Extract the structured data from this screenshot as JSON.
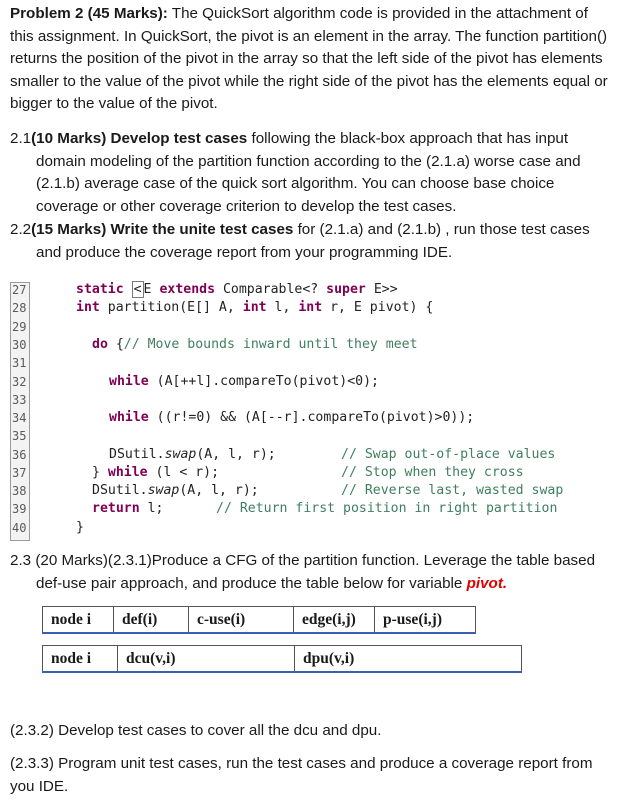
{
  "problem": {
    "heading": "Problem 2 (45 Marks):",
    "intro_1": " The QuickSort algorithm code is provided in the attachment of this assignment. In QuickSort, the pivot is an element in the array. The function partition() returns the position of the pivot in the array so that the left side of the pivot has elements smaller to the value of the pivot while the right side of the pivot has the elements equal or bigger to the value of the pivot."
  },
  "q21": {
    "num": "2.1",
    "bold": "(10 Marks) Develop test cases",
    "text": " following the black-box approach that has input domain modeling of the partition function according to the (2.1.a) worse case and (2.1.b) average case of the quick sort algorithm. You can choose base choice coverage or other coverage criterion to develop the test cases."
  },
  "q22": {
    "num": "2.2",
    "bold": "(15 Marks) Write the unite test cases",
    "text": " for (2.1.a) and (2.1.b) , run those test cases and produce the coverage report from your programming IDE."
  },
  "code": {
    "line_numbers": [
      "27",
      "28",
      "29",
      "30",
      "31",
      "32",
      "33",
      "34",
      "35",
      "36",
      "37",
      "38",
      "39",
      "40"
    ],
    "l27_kw": "static",
    "l27_rest": "E ",
    "l27_kw2": "extends",
    "l27_end": " Comparable<? ",
    "l27_kw3": "super",
    "l27_tail": " E>>",
    "l28_kw": "int",
    "l28_a": " partition(E[] A, ",
    "l28_kw2": "int",
    "l28_b": " l, ",
    "l28_kw3": "int",
    "l28_c": " r, E pivot) {",
    "l30_kw": "do",
    "l30_a": " {",
    "l30_cm": "// Move bounds inward until they meet",
    "l32_kw": "while",
    "l32_a": " (A[++l].compareTo(pivot)<0);",
    "l34_kw": "while",
    "l34_a": " ((r!=0) && (A[--r].compareTo(pivot)>0));",
    "l36_a": "DSutil.",
    "l36_it": "swap",
    "l36_b": "(A, l, r);",
    "l36_cm": "// Swap out-of-place values",
    "l37_a": "} ",
    "l37_kw": "while",
    "l37_b": " (l < r);",
    "l37_cm": "// Stop when they cross",
    "l38_a": "DSutil.",
    "l38_it": "swap",
    "l38_b": "(A, l, r);",
    "l38_cm": "// Reverse last, wasted swap",
    "l39_kw": "return",
    "l39_a": " l;",
    "l39_cm": "// Return first position in right partition",
    "l40_a": "}"
  },
  "q23": {
    "text": "2.3 (20 Marks)(2.3.1)Produce a CFG of the partition function.  Leverage the table based def-use pair approach, and produce the table below for variable ",
    "var": "pivot."
  },
  "table1": [
    "node i",
    "def(i)",
    "c-use(i)",
    "edge(i,j)",
    "p-use(i,j)"
  ],
  "table2": [
    "node i",
    "dcu(v,i)",
    "dpu(v,i)"
  ],
  "q232": "(2.3.2) Develop test cases to cover all the dcu and dpu.",
  "q233": "(2.3.3) Program unit test cases, run the test cases and produce a coverage report from you IDE."
}
